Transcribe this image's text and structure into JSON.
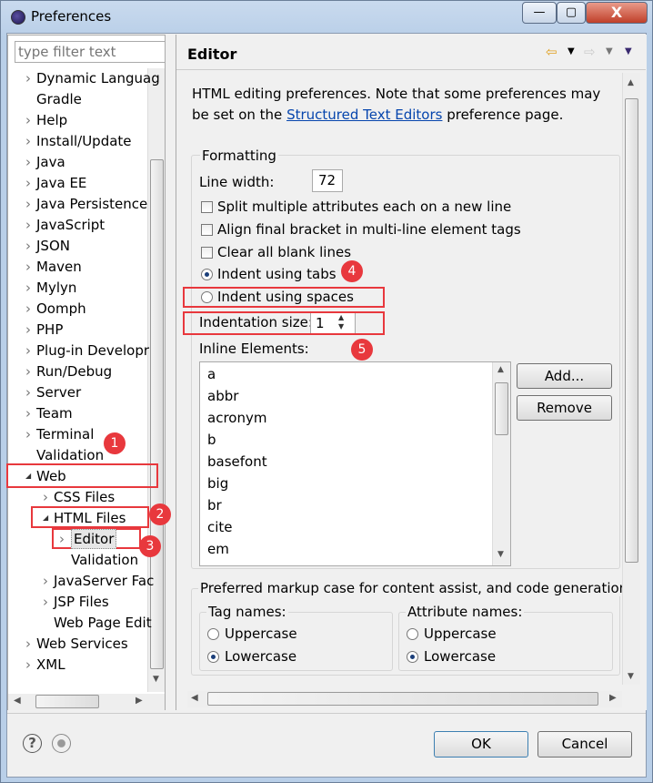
{
  "window": {
    "title": "Preferences",
    "buttons": {
      "minimize": "—",
      "maximize": "▢",
      "close": "X"
    }
  },
  "filter": {
    "placeholder": "type filter text"
  },
  "tree": [
    {
      "label": "Dynamic Languag",
      "level": 0,
      "arrow": "›"
    },
    {
      "label": "Gradle",
      "level": 0,
      "arrow": ""
    },
    {
      "label": "Help",
      "level": 0,
      "arrow": "›"
    },
    {
      "label": "Install/Update",
      "level": 0,
      "arrow": "›"
    },
    {
      "label": "Java",
      "level": 0,
      "arrow": "›"
    },
    {
      "label": "Java EE",
      "level": 0,
      "arrow": "›"
    },
    {
      "label": "Java Persistence",
      "level": 0,
      "arrow": "›"
    },
    {
      "label": "JavaScript",
      "level": 0,
      "arrow": "›"
    },
    {
      "label": "JSON",
      "level": 0,
      "arrow": "›"
    },
    {
      "label": "Maven",
      "level": 0,
      "arrow": "›"
    },
    {
      "label": "Mylyn",
      "level": 0,
      "arrow": "›"
    },
    {
      "label": "Oomph",
      "level": 0,
      "arrow": "›"
    },
    {
      "label": "PHP",
      "level": 0,
      "arrow": "›"
    },
    {
      "label": "Plug-in Developr",
      "level": 0,
      "arrow": "›"
    },
    {
      "label": "Run/Debug",
      "level": 0,
      "arrow": "›"
    },
    {
      "label": "Server",
      "level": 0,
      "arrow": "›"
    },
    {
      "label": "Team",
      "level": 0,
      "arrow": "›"
    },
    {
      "label": "Terminal",
      "level": 0,
      "arrow": "›"
    },
    {
      "label": "Validation",
      "level": 0,
      "arrow": ""
    },
    {
      "label": "Web",
      "level": 0,
      "arrow": "◢"
    },
    {
      "label": "CSS Files",
      "level": 1,
      "arrow": "›"
    },
    {
      "label": "HTML Files",
      "level": 1,
      "arrow": "◢"
    },
    {
      "label": "Editor",
      "level": 2,
      "arrow": "›",
      "selected": true
    },
    {
      "label": "Validation",
      "level": 2,
      "arrow": ""
    },
    {
      "label": "JavaServer Fac",
      "level": 1,
      "arrow": "›"
    },
    {
      "label": "JSP Files",
      "level": 1,
      "arrow": "›"
    },
    {
      "label": "Web Page Edit",
      "level": 1,
      "arrow": ""
    },
    {
      "label": "Web Services",
      "level": 0,
      "arrow": "›"
    },
    {
      "label": "XML",
      "level": 0,
      "arrow": "›"
    }
  ],
  "page": {
    "title": "Editor",
    "desc_before": "HTML editing preferences.  Note that some preferences may be set on the ",
    "desc_link": "Structured Text Editors",
    "desc_after": " preference page."
  },
  "formatting": {
    "title": "Formatting",
    "line_width_label": "Line width:",
    "line_width": "72",
    "split": {
      "label": "Split multiple attributes each on a new line",
      "checked": false
    },
    "align": {
      "label": "Align final bracket in multi-line element tags",
      "checked": false
    },
    "clear": {
      "label": "Clear all blank lines",
      "checked": false
    },
    "tabs": {
      "label": "Indent using tabs",
      "selected": true
    },
    "spaces": {
      "label": "Indent using spaces",
      "selected": false
    },
    "indent_size_label": "Indentation size:",
    "indent_size": "1",
    "inline_label": "Inline Elements:",
    "inline": [
      "a",
      "abbr",
      "acronym",
      "b",
      "basefont",
      "big",
      "br",
      "cite",
      "em"
    ],
    "add": "Add...",
    "remove": "Remove"
  },
  "markup": {
    "title": "Preferred markup case for content assist, and code generation",
    "tag": {
      "title": "Tag names:",
      "upper": "Uppercase",
      "lower": "Lowercase",
      "selected": "Lowercase"
    },
    "attr": {
      "title": "Attribute names:",
      "upper": "Uppercase",
      "lower": "Lowercase",
      "selected": "Lowercase"
    }
  },
  "badges": [
    "1",
    "2",
    "3",
    "4",
    "5"
  ],
  "footer": {
    "ok": "OK",
    "cancel": "Cancel",
    "help_icon": "?"
  },
  "colors": {
    "annotation": "#e8383d",
    "link": "#0645ad"
  }
}
